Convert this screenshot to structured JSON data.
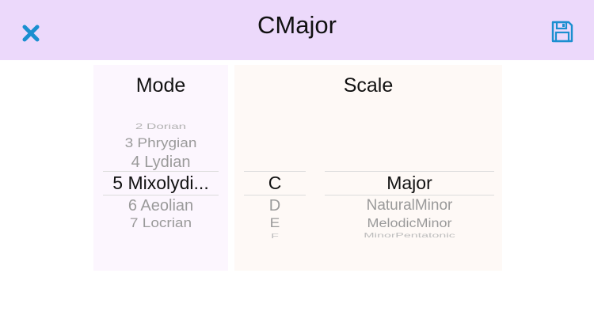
{
  "header": {
    "title": "CMajor",
    "close_icon": "close-x-icon",
    "save_icon": "floppy-disk-icon",
    "accent_color": "#1b8fd0",
    "background_color": "#ecd9fb"
  },
  "mode_panel": {
    "title": "Mode",
    "options": [
      "2 Dorian",
      "3 Phrygian",
      "4 Lydian",
      "5 Mixolydi...",
      "6 Aeolian",
      "7 Locrian"
    ],
    "selected": "5 Mixolydi..."
  },
  "scale_panel": {
    "title": "Scale",
    "root_options": [
      "C",
      "D",
      "E",
      "F"
    ],
    "root_selected": "C",
    "type_options": [
      "Major",
      "NaturalMinor",
      "MelodicMinor",
      "MinorPentatonic"
    ],
    "type_selected": "Major"
  }
}
